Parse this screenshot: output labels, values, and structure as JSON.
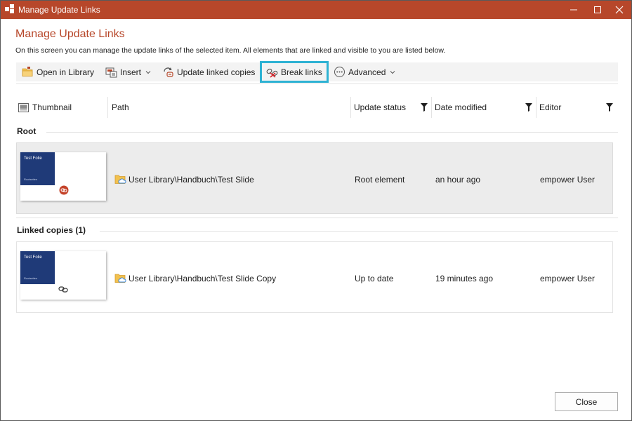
{
  "window": {
    "title": "Manage Update Links"
  },
  "header": {
    "title": "Manage Update Links",
    "subtitle": "On this screen you can manage the update links of the selected item. All elements that are linked and visible to you are listed below."
  },
  "toolbar": {
    "open_in_library": "Open in Library",
    "insert": "Insert",
    "update_linked_copies": "Update linked copies",
    "break_links": "Break links",
    "advanced": "Advanced"
  },
  "columns": {
    "thumbnail": "Thumbnail",
    "path": "Path",
    "update_status": "Update status",
    "date_modified": "Date modified",
    "editor": "Editor"
  },
  "groups": {
    "root": {
      "title": "Root",
      "row": {
        "slide_title": "Test Folie",
        "slide_subtitle": "Rootseiten",
        "path": "User Library\\Handbuch\\Test Slide",
        "update_status": "Root element",
        "date_modified": "an hour ago",
        "editor": "empower User"
      }
    },
    "linked": {
      "title": "Linked copies (1)",
      "row": {
        "slide_title": "Test Folie",
        "slide_subtitle": "Rootseiten",
        "path": "User Library\\Handbuch\\Test Slide Copy",
        "update_status": "Up to date",
        "date_modified": "19 minutes ago",
        "editor": "empower User"
      }
    }
  },
  "footer": {
    "close": "Close"
  },
  "colors": {
    "accent": "#b7472a",
    "highlight": "#2eb2d3",
    "slide_blue": "#1f3a78"
  }
}
